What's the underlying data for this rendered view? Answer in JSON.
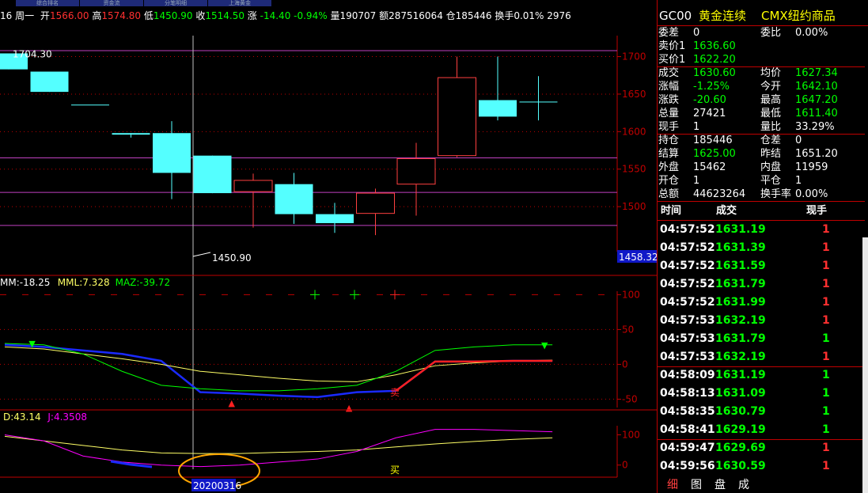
{
  "topbar": {
    "tabs": [
      "综合排名",
      "资金流",
      "分笔明细",
      "上海黄金"
    ]
  },
  "infobar": {
    "date_weekday": "16 周一",
    "open_label": "开",
    "open": "1566.00",
    "high_label": "高",
    "high": "1574.80",
    "low_label": "低",
    "low": "1450.90",
    "close_label": "收",
    "close": "1514.50",
    "change_label": "涨",
    "change": "-14.40",
    "change_pct": "-0.94%",
    "volume_label": "量",
    "volume": "190707",
    "amount_label": "额",
    "amount": "287516064",
    "oi_label": "仓",
    "oi": "185446",
    "turnover_label": "换手",
    "turnover": "0.01%",
    "extra": "2976"
  },
  "chart_data": [
    {
      "type": "candlestick",
      "title": "",
      "x": [
        "k1",
        "k2",
        "k3",
        "k4",
        "k5",
        "k6",
        "k7",
        "k8",
        "k9",
        "k10",
        "k11",
        "k12",
        "k13",
        "k14"
      ],
      "open": [
        1704.3,
        1680,
        1636,
        1598,
        1598,
        1568,
        1520,
        1530,
        1490,
        1491,
        1530,
        1568,
        1642,
        1640
      ],
      "close": [
        1683,
        1653,
        1636,
        1596,
        1545,
        1518,
        1535,
        1490,
        1478,
        1518,
        1564,
        1672,
        1620,
        1640
      ],
      "high": [
        1704.3,
        1680,
        1636,
        1598,
        1614,
        1568,
        1544,
        1545,
        1505,
        1524,
        1585,
        1700,
        1700,
        1674
      ],
      "low": [
        1683,
        1653,
        1636,
        1592,
        1510,
        1518,
        1472,
        1477,
        1465,
        1462,
        1488,
        1566,
        1615,
        1615
      ],
      "ylim": [
        1440,
        1728
      ],
      "yticks": [
        1500,
        1550,
        1600,
        1650,
        1700
      ],
      "high_label": "1704.30",
      "low_label": "1450.90",
      "price_tag": "1458.32",
      "hlines": [
        1708,
        1565,
        1519,
        1475
      ]
    },
    {
      "type": "line",
      "title_items": [
        {
          "text": "MM:-18.25",
          "color": "#ffffff"
        },
        {
          "text": "MML:7.328",
          "color": "#ffff66"
        },
        {
          "text": "MAZ:-39.72",
          "color": "#00ff00"
        }
      ],
      "ylim": [
        -62,
        105
      ],
      "yticks": [
        -50,
        0,
        50,
        100
      ],
      "x_index": [
        0,
        1,
        2,
        3,
        4,
        5,
        6,
        7,
        8,
        9,
        10,
        11,
        12,
        13,
        14
      ],
      "series": [
        {
          "name": "MM",
          "color": "#1a2aff",
          "values": [
            28,
            25,
            20,
            15,
            5,
            -40,
            -42,
            -45,
            -47,
            -40,
            -38,
            4,
            4,
            5,
            5
          ]
        },
        {
          "name": "MML",
          "color": "#ffff66",
          "values": [
            25,
            22,
            15,
            8,
            0,
            -10,
            -15,
            -20,
            -24,
            -25,
            -15,
            -2,
            2,
            5,
            6
          ]
        },
        {
          "name": "MAZ",
          "color": "#00ff00",
          "values": [
            30,
            28,
            15,
            -10,
            -30,
            -35,
            -38,
            -38,
            -35,
            -30,
            -10,
            20,
            25,
            28,
            28
          ]
        }
      ],
      "markers": [
        {
          "x": 0.7,
          "y": 30,
          "symbol": "▼",
          "color": "#00ff00"
        },
        {
          "x": 5.8,
          "y": -55,
          "symbol": "▲",
          "color": "#ff2020"
        },
        {
          "x": 8.8,
          "y": -62,
          "symbol": "▲",
          "color": "#ff2020"
        },
        {
          "x": 13.8,
          "y": 28,
          "symbol": "▼",
          "color": "#00ff00"
        }
      ],
      "signal_text": "卖"
    },
    {
      "type": "line",
      "title_items": [
        {
          "text": "D:43.14",
          "color": "#ffff66"
        },
        {
          "text": "J:4.3508",
          "color": "#ff00ff"
        }
      ],
      "ylim": [
        -40,
        130
      ],
      "yticks": [
        0,
        100
      ],
      "x_index": [
        0,
        1,
        2,
        3,
        4,
        5,
        6,
        7,
        8,
        9,
        10,
        11,
        12,
        13,
        14
      ],
      "series": [
        {
          "name": "D",
          "color": "#ffff66",
          "values": [
            95,
            80,
            65,
            50,
            40,
            38,
            38,
            42,
            45,
            50,
            60,
            70,
            78,
            85,
            90
          ]
        },
        {
          "name": "J",
          "color": "#ff00ff",
          "values": [
            100,
            80,
            30,
            10,
            0,
            -5,
            0,
            10,
            20,
            45,
            90,
            118,
            118,
            114,
            110
          ]
        }
      ],
      "date_label": "20200316",
      "signal_text": "买"
    }
  ],
  "quote": {
    "code": "GC00",
    "name": "黄金连续",
    "market": "CMX纽约商品",
    "rows": [
      {
        "l1": "委差",
        "v1": "0",
        "c1": "#ffffff",
        "l2": "委比",
        "v2": "0.00%",
        "c2": "#ffffff"
      },
      {
        "l1": "卖价1",
        "v1": "1636.60",
        "c1": "#00ff00"
      },
      {
        "l1": "买价1",
        "v1": "1622.20",
        "c1": "#00ff00"
      },
      {
        "l1": "成交",
        "v1": "1630.60",
        "c1": "#00ff00",
        "l2": "均价",
        "v2": "1627.34",
        "c2": "#00ff00"
      },
      {
        "l1": "涨幅",
        "v1": "-1.25%",
        "c1": "#00ff00",
        "l2": "今开",
        "v2": "1642.10",
        "c2": "#00ff00"
      },
      {
        "l1": "涨跌",
        "v1": "-20.60",
        "c1": "#00ff00",
        "l2": "最高",
        "v2": "1647.20",
        "c2": "#00ff00"
      },
      {
        "l1": "总量",
        "v1": "27421",
        "c1": "#ffffff",
        "l2": "最低",
        "v2": "1611.40",
        "c2": "#00ff00"
      },
      {
        "l1": "现手",
        "v1": "1",
        "c1": "#ffffff",
        "l2": "量比",
        "v2": "33.29%",
        "c2": "#ffffff"
      },
      {
        "l1": "持仓",
        "v1": "185446",
        "c1": "#ffffff",
        "l2": "仓差",
        "v2": "0",
        "c2": "#ffffff"
      },
      {
        "l1": "结算",
        "v1": "1625.00",
        "c1": "#00ff00",
        "l2": "昨结",
        "v2": "1651.20",
        "c2": "#ffffff"
      },
      {
        "l1": "外盘",
        "v1": "15462",
        "c1": "#ffffff",
        "l2": "内盘",
        "v2": "11959",
        "c2": "#ffffff"
      },
      {
        "l1": "开仓",
        "v1": "1",
        "c1": "#ffffff",
        "l2": "平仓",
        "v2": "1",
        "c2": "#ffffff"
      },
      {
        "l1": "总额",
        "v1": "44623264",
        "c1": "#ffffff",
        "l2": "换手率",
        "v2": "0.00%",
        "c2": "#ffffff"
      }
    ]
  },
  "ticks": {
    "headers": [
      "时间",
      "成交",
      "现手"
    ],
    "rows": [
      {
        "time": "04:57:52",
        "price": "1631.19",
        "vol": "1",
        "vc": "#ff3030"
      },
      {
        "time": "04:57:52",
        "price": "1631.39",
        "vol": "1",
        "vc": "#ff3030"
      },
      {
        "time": "04:57:52",
        "price": "1631.59",
        "vol": "1",
        "vc": "#ff3030"
      },
      {
        "time": "04:57:52",
        "price": "1631.79",
        "vol": "1",
        "vc": "#ff3030"
      },
      {
        "time": "04:57:52",
        "price": "1631.99",
        "vol": "1",
        "vc": "#ff3030"
      },
      {
        "time": "04:57:53",
        "price": "1632.19",
        "vol": "1",
        "vc": "#ff3030"
      },
      {
        "time": "04:57:53",
        "price": "1631.79",
        "vol": "1",
        "vc": "#00ff00"
      },
      {
        "time": "04:57:53",
        "price": "1632.19",
        "vol": "1",
        "vc": "#ff3030"
      },
      {
        "time": "04:58:09",
        "price": "1631.19",
        "vol": "1",
        "vc": "#00ff00"
      },
      {
        "time": "04:58:13",
        "price": "1631.09",
        "vol": "1",
        "vc": "#00ff00"
      },
      {
        "time": "04:58:35",
        "price": "1630.79",
        "vol": "1",
        "vc": "#00ff00"
      },
      {
        "time": "04:58:41",
        "price": "1629.19",
        "vol": "1",
        "vc": "#00ff00"
      },
      {
        "time": "04:59:47",
        "price": "1629.69",
        "vol": "1",
        "vc": "#ff3030"
      },
      {
        "time": "04:59:56",
        "price": "1630.59",
        "vol": "1",
        "vc": "#ff3030"
      }
    ]
  },
  "tabs": [
    "细",
    "图",
    "盘",
    "成"
  ],
  "colors": {
    "up": "#ff3030",
    "down": "#00ff00",
    "flat": "#ffffff",
    "panel_border": "#c00000",
    "candle_down": "#54ffff",
    "candle_up": "#ff4040",
    "grid": "#c00000",
    "hline": "#c040c0"
  }
}
